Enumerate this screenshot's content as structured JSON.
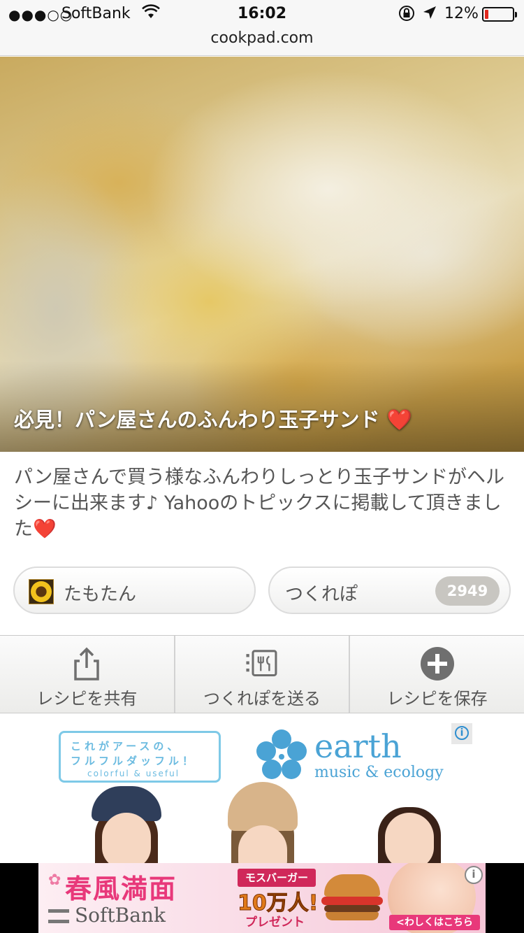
{
  "status_bar": {
    "signal": "●●●○○",
    "carrier": "SoftBank",
    "wifi_icon": "wifi-icon",
    "time": "16:02",
    "battery_percent": "12%",
    "battery_level": 0.12,
    "battery_color": "#e0281e"
  },
  "browser": {
    "url": "cookpad.com"
  },
  "recipe": {
    "title": "必見！パン屋さんのふんわり玉子サンド",
    "title_emoji": "❤️",
    "description": "パン屋さんで買う様なふんわりしっとり玉子サンドがヘルシーに出来ます♪ Yahooのトピックスに掲載して頂きました",
    "description_emoji": "❤️",
    "author_name": "たもたん",
    "tsukurepo_label": "つくれぽ",
    "tsukurepo_count": "2949"
  },
  "actions": [
    {
      "label": "レシピを共有",
      "icon": "share-icon"
    },
    {
      "label": "つくれぽを送る",
      "icon": "tsukurepo-icon"
    },
    {
      "label": "レシピを保存",
      "icon": "add-icon"
    }
  ],
  "ad_earth": {
    "tagline_line1": "これがアースの、",
    "tagline_line2": "フルフルダッフル！",
    "tagline_line3": "colorful & useful",
    "brand": "earth",
    "brand_sub": "music & ecology",
    "accent_color": "#4aa3d5"
  },
  "ad_softbank": {
    "headline": "春風満面",
    "brand": "SoftBank",
    "promo_top": "モスバーガー",
    "promo_main": "10万人!",
    "promo_bottom": "プレゼント",
    "cta": "<わしくはこちら>>",
    "accent_color": "#e8387a"
  }
}
